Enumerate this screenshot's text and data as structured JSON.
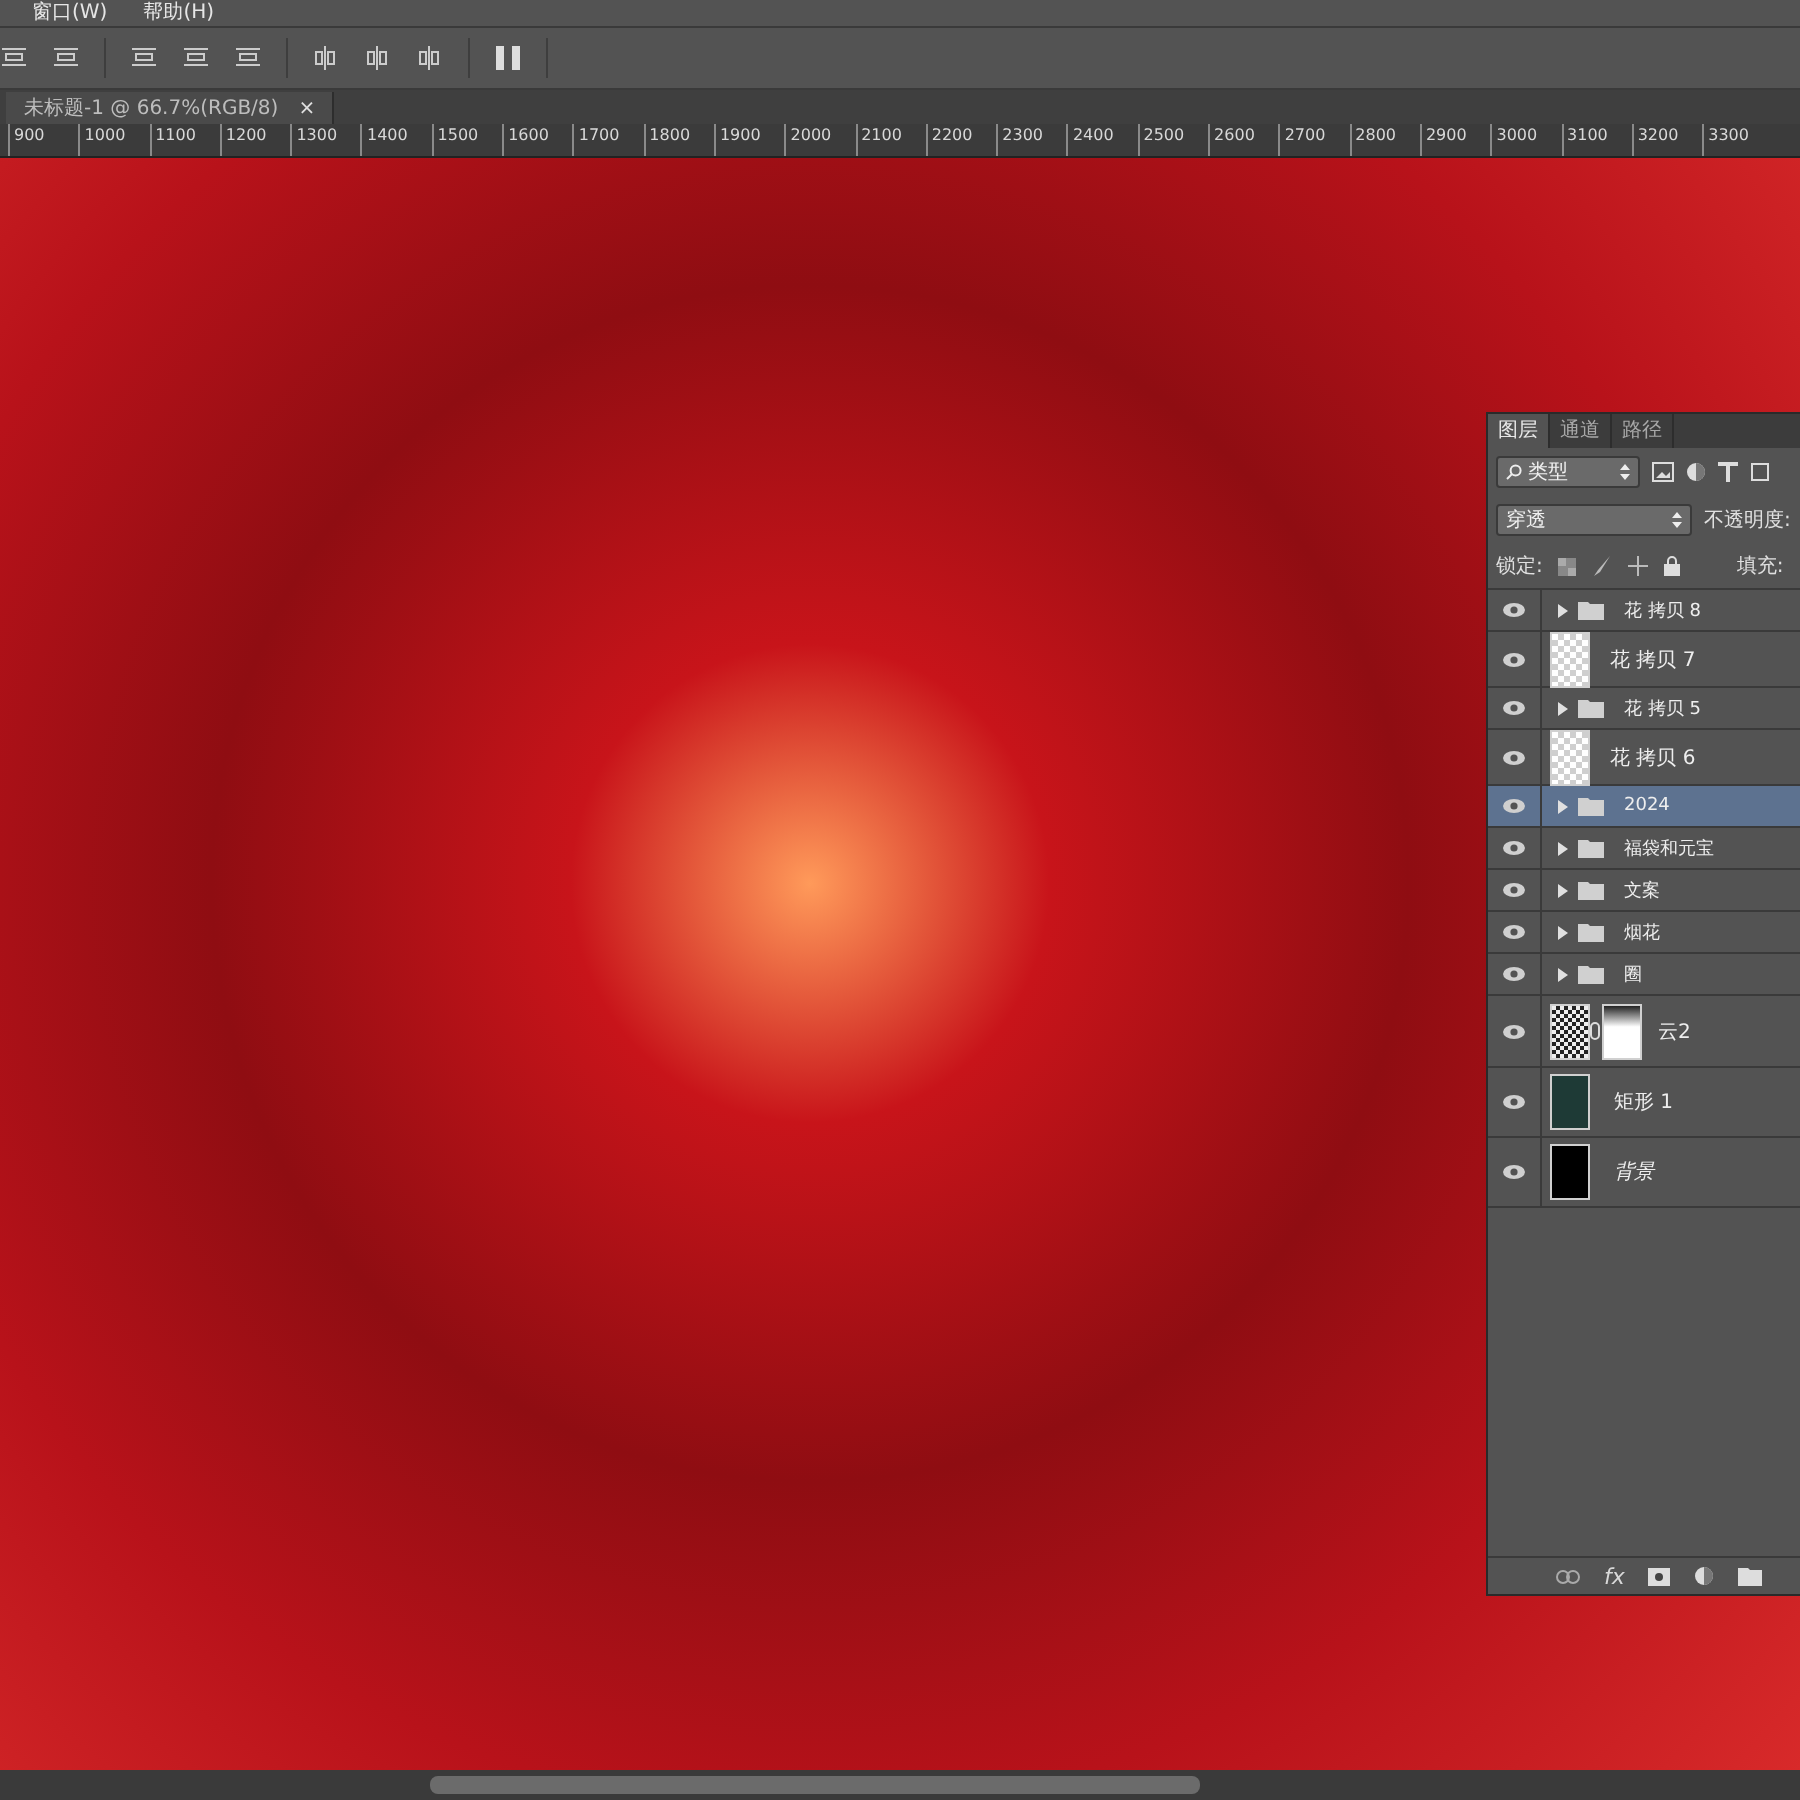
{
  "menu_bar": [
    "窗口(W)",
    "帮助(H)"
  ],
  "document_tab": {
    "title": "未标题-1 @ 66.7%(RGB/8)",
    "close": "×"
  },
  "ruler": [
    "900",
    "1000",
    "1100",
    "1200",
    "1300",
    "1400",
    "1500",
    "1600",
    "1700",
    "1800",
    "1900",
    "2000",
    "2100",
    "2200",
    "2300",
    "2400",
    "2500",
    "2600",
    "2700",
    "2800",
    "2900",
    "3000",
    "3100",
    "3200",
    "3300"
  ],
  "layers_panel": {
    "tabs": [
      {
        "label": "图层",
        "selected": true
      },
      {
        "label": "通道",
        "selected": false
      },
      {
        "label": "路径",
        "selected": false
      }
    ],
    "filter": "类型",
    "blend_mode": "穿透",
    "opacity_label": "不透明度:",
    "lock_label": "锁定:",
    "fill_label": "填充:",
    "layers": [
      {
        "name": "花 拷贝 8",
        "kind": "group",
        "visible": true,
        "selected": false
      },
      {
        "name": "花 拷贝 7",
        "kind": "pixel",
        "visible": true,
        "selected": false
      },
      {
        "name": "花 拷贝 5",
        "kind": "group",
        "visible": true,
        "selected": false
      },
      {
        "name": "花 拷贝 6",
        "kind": "pixel",
        "visible": true,
        "selected": false
      },
      {
        "name": "2024",
        "kind": "group",
        "visible": true,
        "selected": true
      },
      {
        "name": "福袋和元宝",
        "kind": "group",
        "visible": true,
        "selected": false
      },
      {
        "name": "文案",
        "kind": "group",
        "visible": true,
        "selected": false
      },
      {
        "name": "烟花",
        "kind": "group",
        "visible": true,
        "selected": false
      },
      {
        "name": "圈",
        "kind": "group",
        "visible": true,
        "selected": false
      },
      {
        "name": "云2",
        "kind": "masked",
        "visible": true,
        "selected": false
      },
      {
        "name": "矩形 1",
        "kind": "shape",
        "visible": true,
        "selected": false
      },
      {
        "name": "背景",
        "kind": "background",
        "visible": true,
        "selected": false
      }
    ],
    "fx_label": "fx"
  }
}
